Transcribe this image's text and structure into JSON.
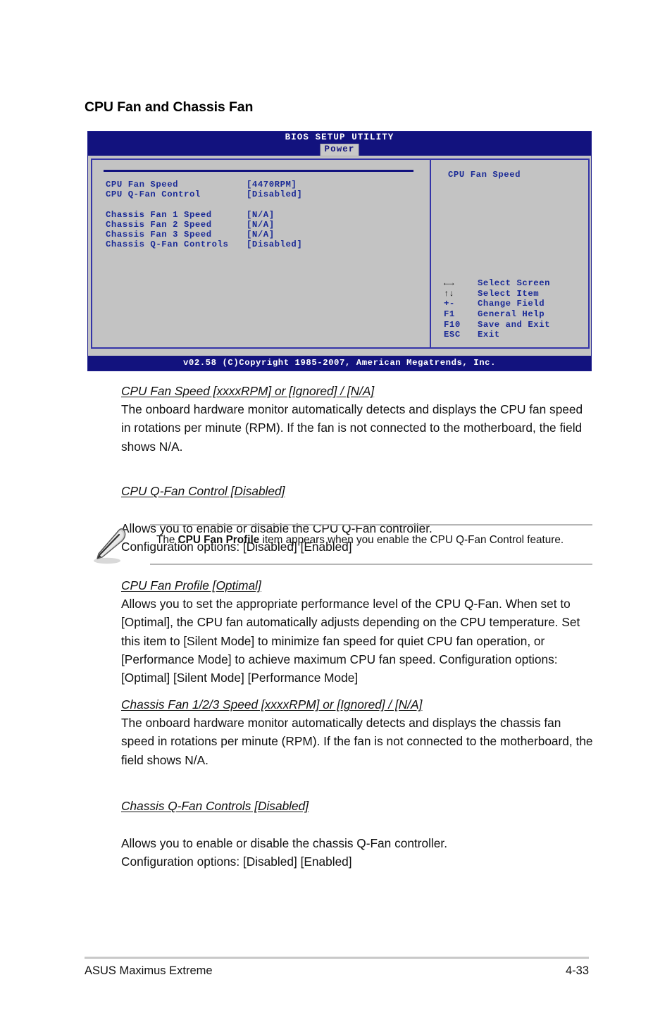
{
  "page": {
    "section_title": "CPU Fan and Chassis Fan",
    "footer_left": "ASUS Maximus Extreme",
    "footer_right": "4-33"
  },
  "bios": {
    "title": "BIOS SETUP UTILITY",
    "tab": "Power",
    "items": [
      {
        "label": "CPU Fan Speed",
        "value": "[4470RPM]"
      },
      {
        "label": "CPU Q-Fan Control",
        "value": "[Disabled]"
      },
      {
        "label": "Chassis Fan 1 Speed",
        "value": "[N/A]"
      },
      {
        "label": "Chassis Fan 2 Speed",
        "value": "[N/A]"
      },
      {
        "label": "Chassis Fan 3 Speed",
        "value": "[N/A]"
      },
      {
        "label": "Chassis Q-Fan Controls",
        "value": "[Disabled]"
      }
    ],
    "help_title": "CPU Fan Speed",
    "legend": [
      {
        "key": "←→",
        "desc": "Select Screen",
        "glyph": true
      },
      {
        "key": "↑↓",
        "desc": "Select Item",
        "glyph": true
      },
      {
        "key": "+-",
        "desc": "Change Field",
        "glyph": false
      },
      {
        "key": "F1",
        "desc": "General Help",
        "glyph": false
      },
      {
        "key": "F10",
        "desc": "Save and Exit",
        "glyph": false
      },
      {
        "key": "ESC",
        "desc": "Exit",
        "glyph": false
      }
    ],
    "footer": "v02.58 (C)Copyright 1985-2007, American Megatrends, Inc.",
    "colors": {
      "header_bg": "#12127e",
      "screen_bg": "#c3c3c3",
      "text_blue": "#1a2a96",
      "tab_bg": "#c8c8c8"
    }
  },
  "sections": {
    "cpu_fan_speed": {
      "head": "CPU Fan Speed [xxxxRPM] or [Ignored] / [N/A]",
      "body": "The onboard hardware monitor automatically detects and displays the CPU fan speed in rotations per minute (RPM). If the fan is not connected to the motherboard, the field shows N/A."
    },
    "cpu_qfan_control": {
      "head": "CPU Q-Fan Control [Disabled]",
      "body": "Allows you to enable or disable the CPU Q-Fan controller.\nConfiguration options: [Disabled] [Enabled]"
    },
    "cpu_fan_profile": {
      "head": "CPU Fan Profile [Optimal]",
      "body": "Allows you to set the appropriate performance level of the CPU Q-Fan. When set to [Optimal], the CPU fan automatically adjusts depending on the CPU temperature. Set this item to [Silent Mode] to minimize fan speed for quiet CPU fan operation, or [Performance Mode] to achieve maximum CPU fan speed. Configuration options: [Optimal] [Silent Mode] [Performance Mode]"
    },
    "chassis_fan_speed": {
      "head": "Chassis Fan 1/2/3 Speed [xxxxRPM] or [Ignored] / [N/A]",
      "body": "The onboard hardware monitor automatically detects and displays the chassis fan speed in rotations per minute (RPM). If the fan is not connected to the motherboard, the field shows N/A."
    },
    "chassis_qfan_controls": {
      "head": "Chassis Q-Fan Controls [Disabled]",
      "body": "Allows you to enable or disable the chassis Q-Fan controller.\nConfiguration options: [Disabled] [Enabled]"
    }
  },
  "note": {
    "text_before": "The ",
    "text_bold": "CPU Fan Profile",
    "text_after": " item appears when you enable the CPU Q-Fan Control feature.",
    "icon": "pencil-note-icon"
  }
}
